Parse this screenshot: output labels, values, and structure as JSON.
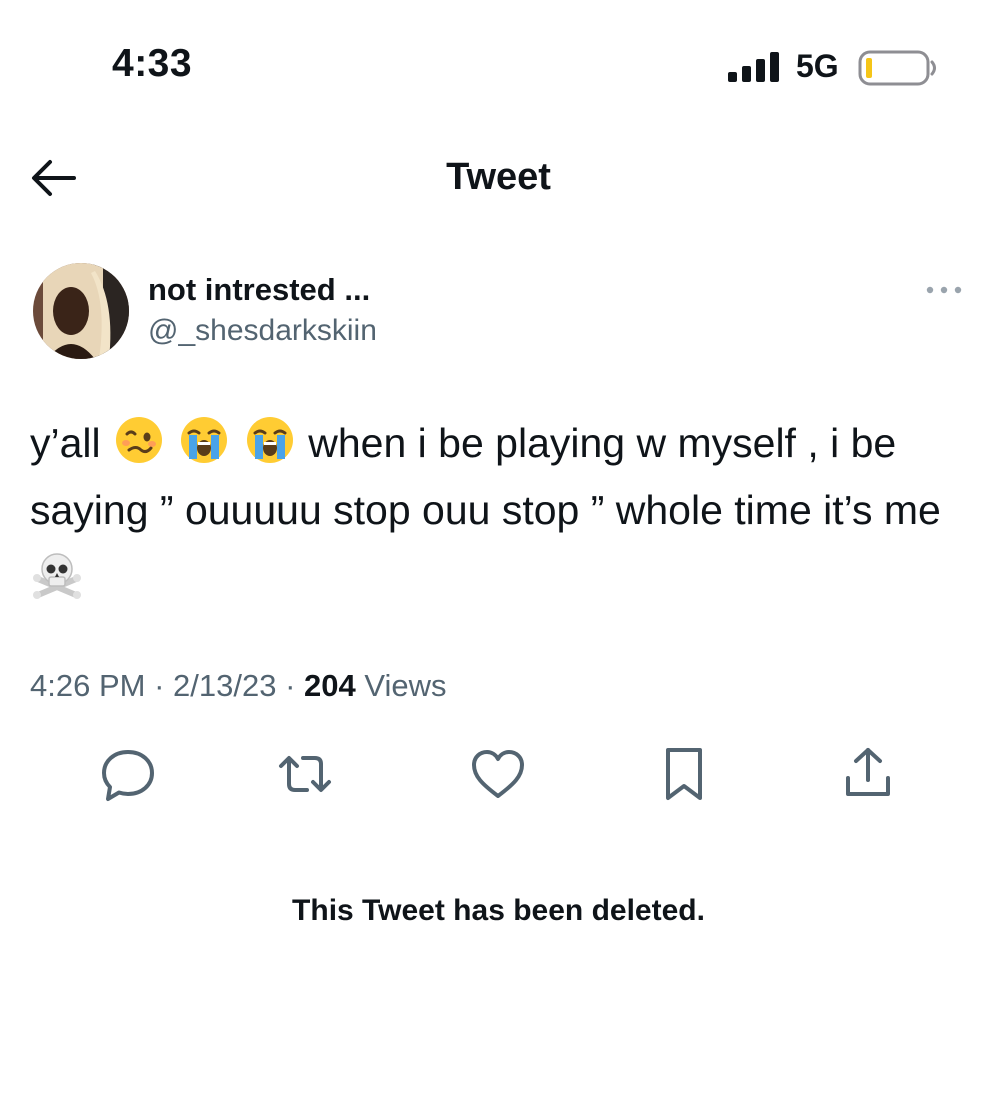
{
  "status_bar": {
    "time": "4:33",
    "network": "5G",
    "signal_icon": "signal-bars-icon",
    "battery_icon": "battery-icon"
  },
  "header": {
    "title": "Tweet",
    "back_icon": "back-arrow-icon"
  },
  "tweet": {
    "author": {
      "display_name": "not intrested ...",
      "handle": "@_shesdarkskiin"
    },
    "text_segments": {
      "s1": "y’all",
      "s2": " when i be playing w myself , i be saying ” ouuuuu stop ouu stop ” whole time it’s me "
    },
    "emojis": [
      "woozy-face-emoji",
      "loudly-crying-face-emoji",
      "loudly-crying-face-emoji",
      "skull-and-crossbones-emoji"
    ],
    "meta": {
      "time": "4:26 PM",
      "sep": " · ",
      "date": "2/13/23",
      "views_count": "204",
      "views_label": " Views"
    }
  },
  "actions": [
    "reply-icon",
    "retweet-icon",
    "like-icon",
    "bookmark-icon",
    "share-icon"
  ],
  "notice": "This Tweet has been deleted.",
  "colors": {
    "text": "#0f1419",
    "secondary": "#536471",
    "background": "#ffffff",
    "battery_low": "#f5c518"
  }
}
